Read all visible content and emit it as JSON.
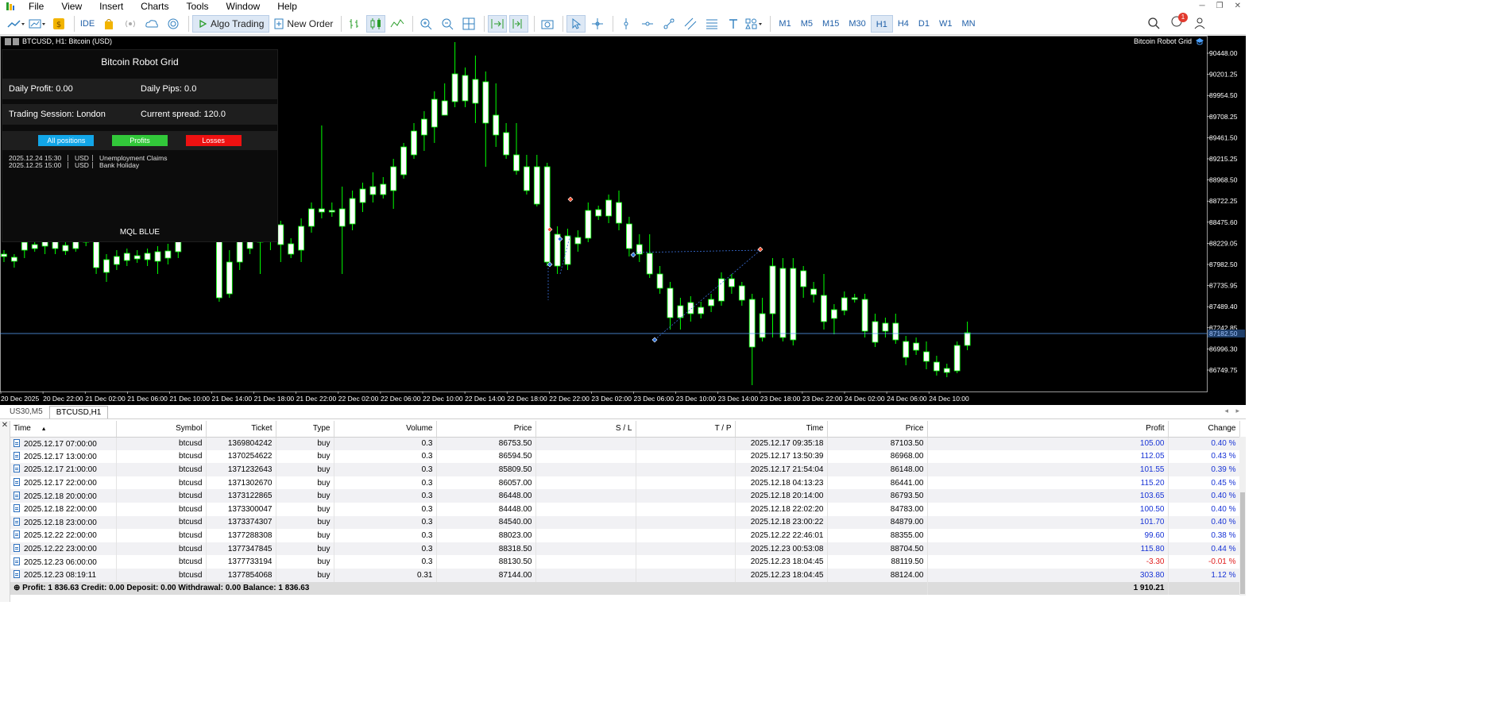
{
  "menu": {
    "items": [
      "File",
      "View",
      "Insert",
      "Charts",
      "Tools",
      "Window",
      "Help"
    ]
  },
  "toolbar": {
    "ide_label": "IDE",
    "algo_trading_label": "Algo Trading",
    "new_order_label": "New Order",
    "timeframes": [
      "M1",
      "M5",
      "M15",
      "M30",
      "H1",
      "H4",
      "D1",
      "W1",
      "MN"
    ],
    "active_timeframe": "H1",
    "notification_count": "1"
  },
  "chart": {
    "title": "BTCUSD, H1:  Bitcoin (USD)",
    "ea_name": "Bitcoin Robot Grid",
    "current_price_label": "87182.50",
    "price_axis": [
      "90448.00",
      "90201.25",
      "89954.50",
      "89708.25",
      "89461.50",
      "89215.25",
      "88968.50",
      "88722.25",
      "88475.60",
      "88229.05",
      "87982.50",
      "87735.95",
      "87489.40",
      "87242.85",
      "86996.30",
      "86749.75"
    ],
    "time_axis": [
      "20 Dec 2025",
      "20 Dec 22:00",
      "21 Dec 02:00",
      "21 Dec 06:00",
      "21 Dec 10:00",
      "21 Dec 14:00",
      "21 Dec 18:00",
      "21 Dec 22:00",
      "22 Dec 02:00",
      "22 Dec 06:00",
      "22 Dec 10:00",
      "22 Dec 14:00",
      "22 Dec 18:00",
      "22 Dec 22:00",
      "23 Dec 02:00",
      "23 Dec 06:00",
      "23 Dec 10:00",
      "23 Dec 14:00",
      "23 Dec 18:00",
      "23 Dec 22:00",
      "24 Dec 02:00",
      "24 Dec 06:00",
      "24 Dec 10:00"
    ],
    "colors": {
      "bull": "#ffffff",
      "bear": "#ffffff",
      "wick": "#00ff00",
      "background": "#000000",
      "hline": "#5aa7ff"
    }
  },
  "robot_panel": {
    "title": "Bitcoin Robot Grid",
    "daily_profit": "Daily Profit: 0.00",
    "daily_pips": "Daily Pips:  0.0",
    "session": "Trading Session: London",
    "spread": "Current spread: 120.0",
    "btn_all": "All positions",
    "btn_profits": "Profits",
    "btn_losses": "Losses",
    "news": [
      {
        "time": "2025.12.24 15:30",
        "cur": "USD",
        "event": "Unemployment Claims"
      },
      {
        "time": "2025.12.25 15:00",
        "cur": "USD",
        "event": "Bank Holiday"
      }
    ],
    "footer": "MQL BLUE"
  },
  "tabs": [
    "US30,M5",
    "BTCUSD,H1"
  ],
  "table": {
    "headers": [
      "Time",
      "Symbol",
      "Ticket",
      "Type",
      "Volume",
      "Price",
      "S / L",
      "T / P",
      "Time",
      "Price",
      "Profit",
      "Change"
    ],
    "rows": [
      [
        "2025.12.17 07:00:00",
        "btcusd",
        "1369804242",
        "buy",
        "0.3",
        "86753.50",
        "",
        "",
        "2025.12.17 09:35:18",
        "87103.50",
        "105.00",
        "0.40 %"
      ],
      [
        "2025.12.17 13:00:00",
        "btcusd",
        "1370254622",
        "buy",
        "0.3",
        "86594.50",
        "",
        "",
        "2025.12.17 13:50:39",
        "86968.00",
        "112.05",
        "0.43 %"
      ],
      [
        "2025.12.17 21:00:00",
        "btcusd",
        "1371232643",
        "buy",
        "0.3",
        "85809.50",
        "",
        "",
        "2025.12.17 21:54:04",
        "86148.00",
        "101.55",
        "0.39 %"
      ],
      [
        "2025.12.17 22:00:00",
        "btcusd",
        "1371302670",
        "buy",
        "0.3",
        "86057.00",
        "",
        "",
        "2025.12.18 04:13:23",
        "86441.00",
        "115.20",
        "0.45 %"
      ],
      [
        "2025.12.18 20:00:00",
        "btcusd",
        "1373122865",
        "buy",
        "0.3",
        "86448.00",
        "",
        "",
        "2025.12.18 20:14:00",
        "86793.50",
        "103.65",
        "0.40 %"
      ],
      [
        "2025.12.18 22:00:00",
        "btcusd",
        "1373300047",
        "buy",
        "0.3",
        "84448.00",
        "",
        "",
        "2025.12.18 22:02:20",
        "84783.00",
        "100.50",
        "0.40 %"
      ],
      [
        "2025.12.18 23:00:00",
        "btcusd",
        "1373374307",
        "buy",
        "0.3",
        "84540.00",
        "",
        "",
        "2025.12.18 23:00:22",
        "84879.00",
        "101.70",
        "0.40 %"
      ],
      [
        "2025.12.22 22:00:00",
        "btcusd",
        "1377288308",
        "buy",
        "0.3",
        "88023.00",
        "",
        "",
        "2025.12.22 22:46:01",
        "88355.00",
        "99.60",
        "0.38 %"
      ],
      [
        "2025.12.22 23:00:00",
        "btcusd",
        "1377347845",
        "buy",
        "0.3",
        "88318.50",
        "",
        "",
        "2025.12.23 00:53:08",
        "88704.50",
        "115.80",
        "0.44 %"
      ],
      [
        "2025.12.23 06:00:00",
        "btcusd",
        "1377733194",
        "buy",
        "0.3",
        "88130.50",
        "",
        "",
        "2025.12.23 18:04:45",
        "88119.50",
        "-3.30",
        "-0.01 %"
      ],
      [
        "2025.12.23 08:19:11",
        "btcusd",
        "1377854068",
        "buy",
        "0.31",
        "87144.00",
        "",
        "",
        "2025.12.23 18:04:45",
        "88124.00",
        "303.80",
        "1.12 %"
      ]
    ],
    "summary": "Profit: 1 836.63  Credit: 0.00  Deposit: 0.00  Withdrawal: 0.00  Balance: 1 836.63",
    "summary_total": "1 910.21"
  }
}
